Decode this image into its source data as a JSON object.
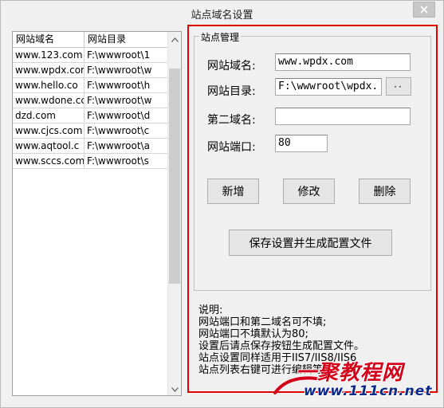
{
  "window": {
    "title": "站点域名设置",
    "close_icon": "close-icon"
  },
  "site_list": {
    "columns": [
      "网站域名",
      "网站目录"
    ],
    "rows": [
      [
        "www.123.com",
        "F:\\wwwroot\\1"
      ],
      [
        "www.wpdx.com",
        "F:\\wwwroot\\w"
      ],
      [
        "www.hello.co",
        "F:\\wwwroot\\h"
      ],
      [
        "www.wdone.cc",
        "F:\\wwwroot\\w"
      ],
      [
        "dzd.com",
        "F:\\wwwroot\\d"
      ],
      [
        "www.cjcs.com",
        "F:\\wwwroot\\c"
      ],
      [
        "www.aqtool.c",
        "F:\\wwwroot\\a"
      ],
      [
        "www.sccs.com",
        "F:\\wwwroot\\s"
      ]
    ]
  },
  "site_manage": {
    "group_label": "站点管理",
    "domain_label": "网站域名:",
    "domain_value": "www.wpdx.com",
    "dir_label": "网站目录:",
    "dir_value": "F:\\wwwroot\\wpdx.",
    "browse_label": "··",
    "second_domain_label": "第二域名:",
    "second_domain_value": "",
    "port_label": "网站端口:",
    "port_value": "80",
    "add_label": "新增",
    "edit_label": "修改",
    "delete_label": "删除",
    "save_label": "保存设置并生成配置文件"
  },
  "notes": {
    "lines": [
      "说明:",
      "网站端口和第二域名可不填;",
      "网站端口不填默认为80;",
      "设置后请点保存按钮生成配置文件。",
      "站点设置同样适用于IIS7/IIS8/IIS6",
      "站点列表右键可进行编辑等"
    ]
  },
  "watermark": {
    "top": "一聚教程网",
    "bottom": "www.111cn.net"
  },
  "colors": {
    "highlight": "#e00000",
    "watermark_red": "#d4001a",
    "watermark_blue": "#0a2a8a"
  }
}
